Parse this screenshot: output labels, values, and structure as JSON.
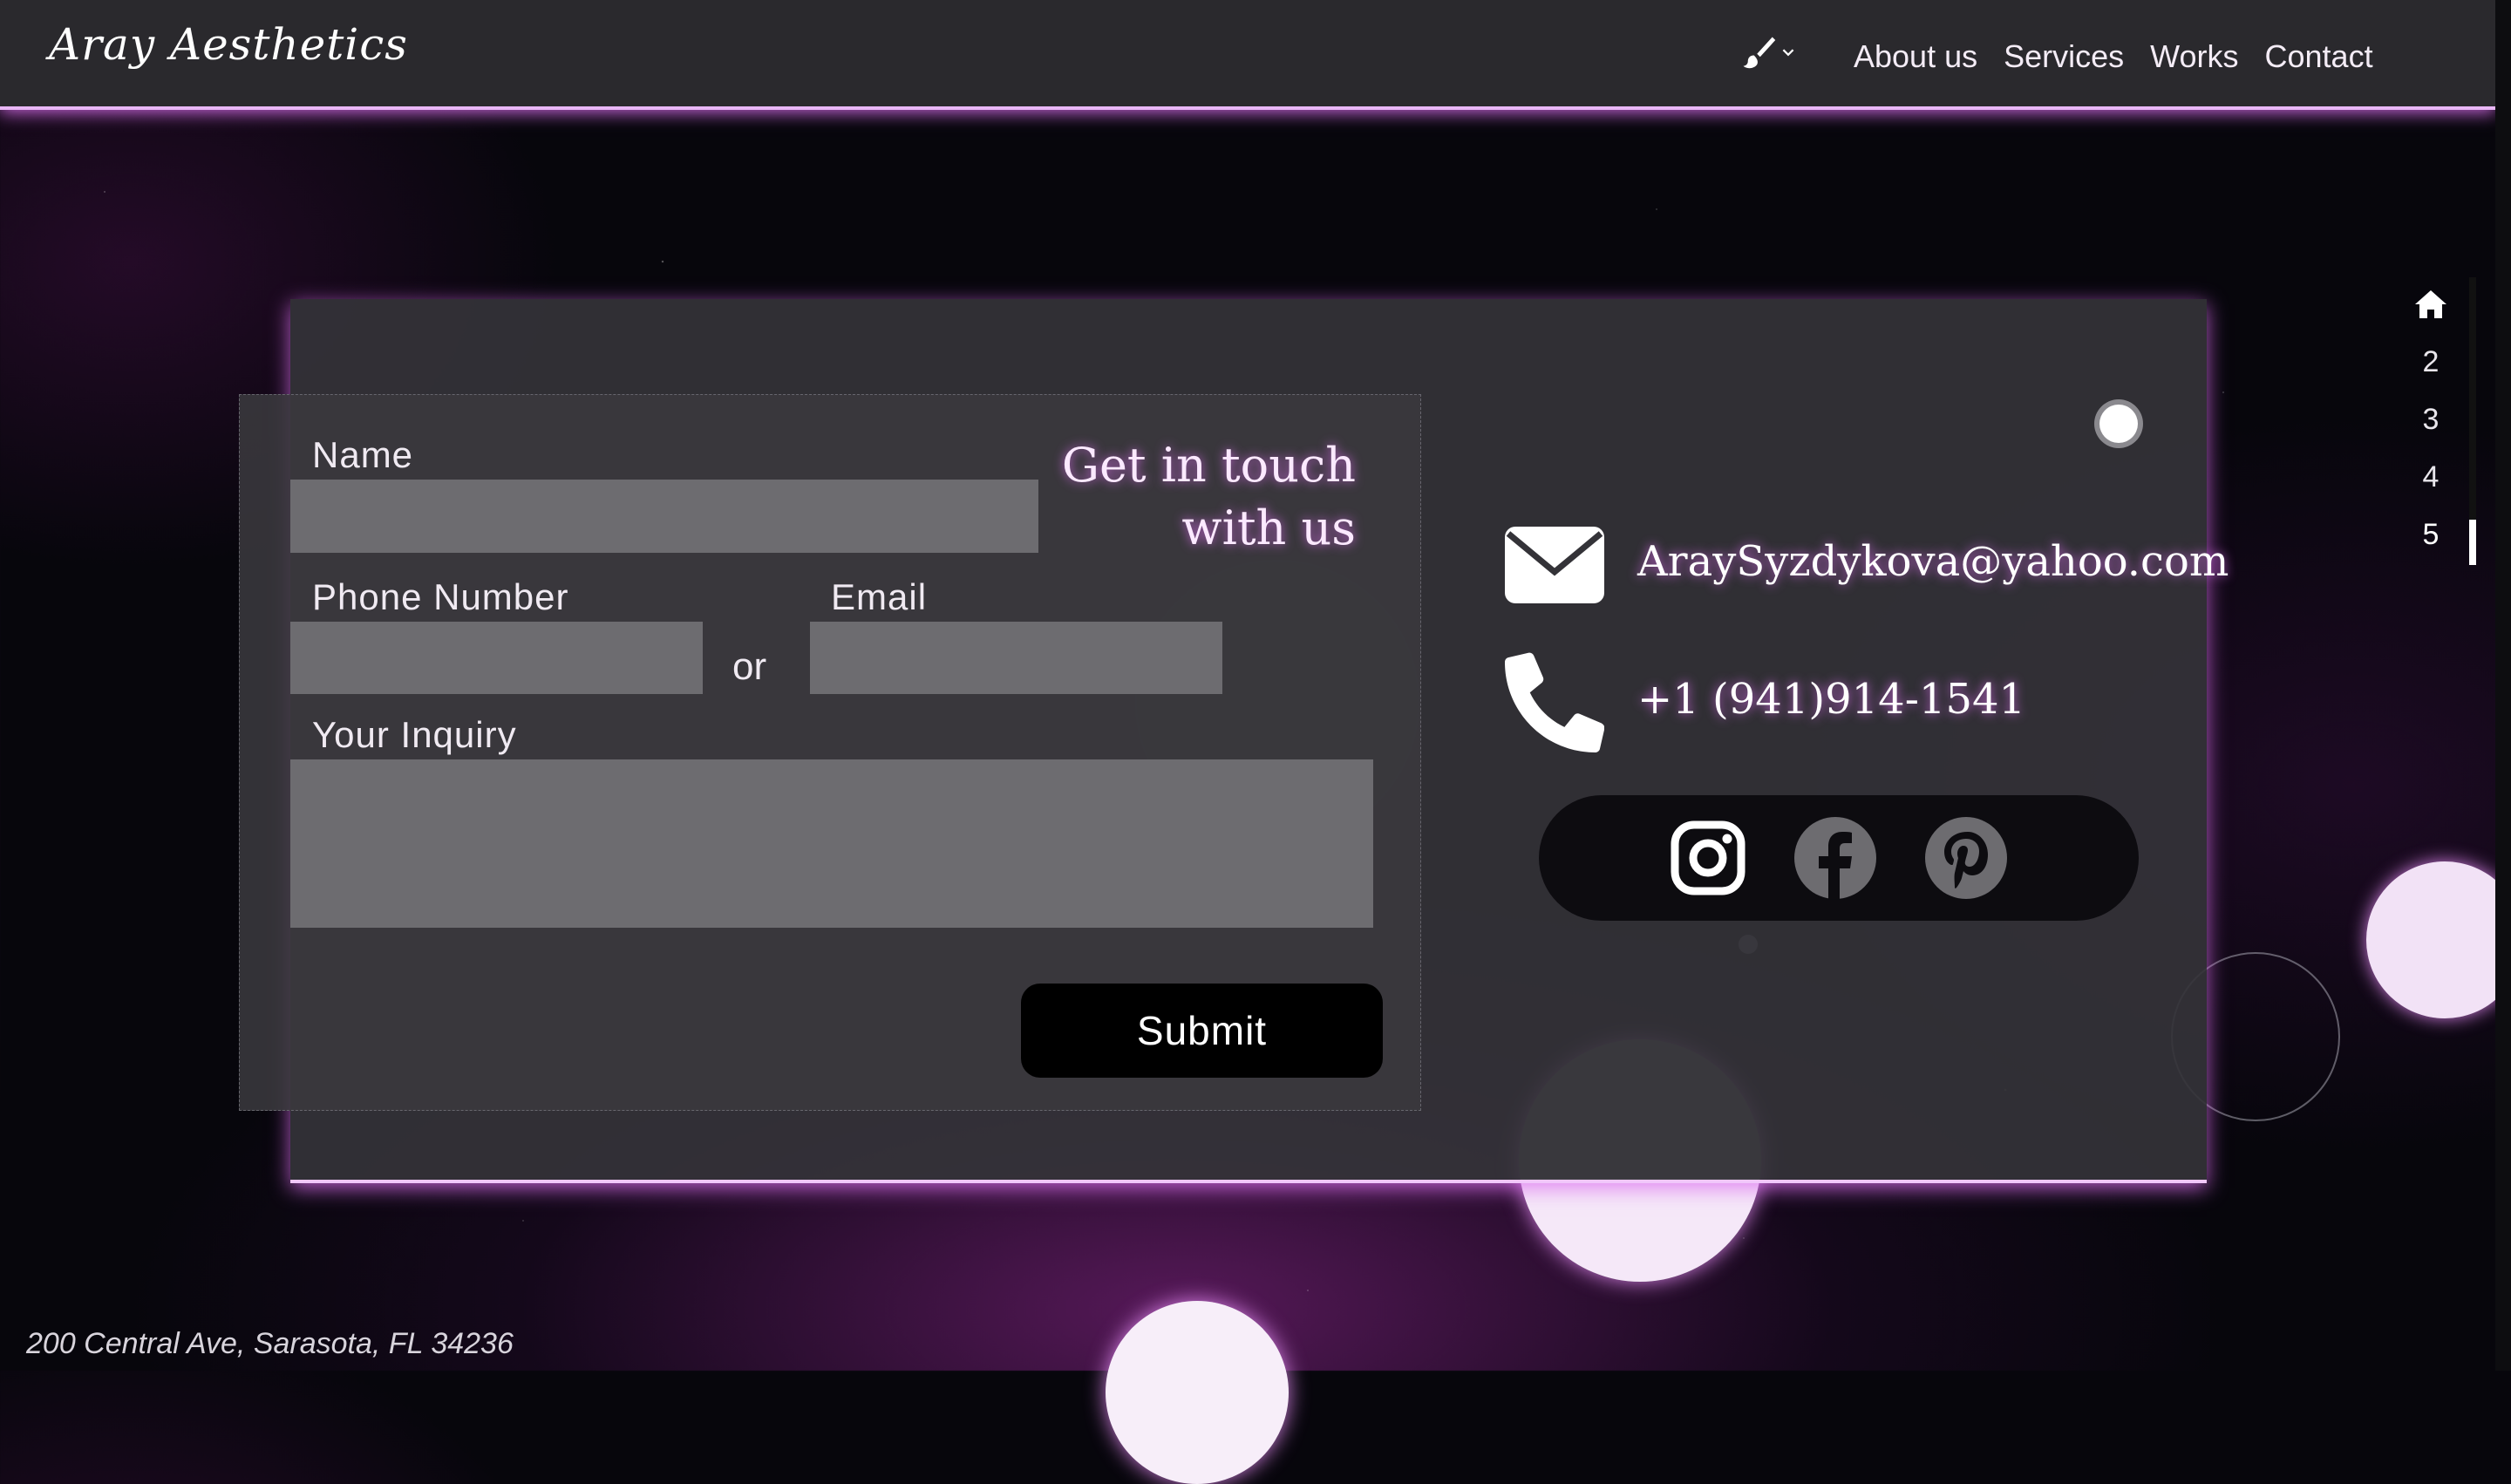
{
  "header": {
    "logo": "Aray Aesthetics",
    "theme_icon": "paintbrush-icon",
    "nav": [
      "About us",
      "Services",
      "Works",
      "Contact"
    ]
  },
  "form": {
    "name_label": "Name",
    "phone_label": "Phone Number",
    "or_text": "or",
    "email_label": "Email",
    "inquiry_label": "Your Inquiry",
    "heading_line1": "Get in touch",
    "heading_line2": "with us",
    "submit_label": "Submit"
  },
  "contact": {
    "email": "ArаySyzdykova@yahoo.com",
    "phone": "+1 (941)914-1541",
    "socials": [
      "instagram-icon",
      "facebook-icon",
      "pinterest-icon"
    ]
  },
  "sidenav": {
    "home_icon": "home-icon",
    "items": [
      "2",
      "3",
      "4",
      "5"
    ]
  },
  "footer": {
    "address": "200 Central Ave, Sarasota, FL 34236"
  },
  "colors": {
    "glow": "#e9b6f6",
    "card": "#343338",
    "field": "#6d6c70",
    "accent_text": "#fbe9ff"
  }
}
